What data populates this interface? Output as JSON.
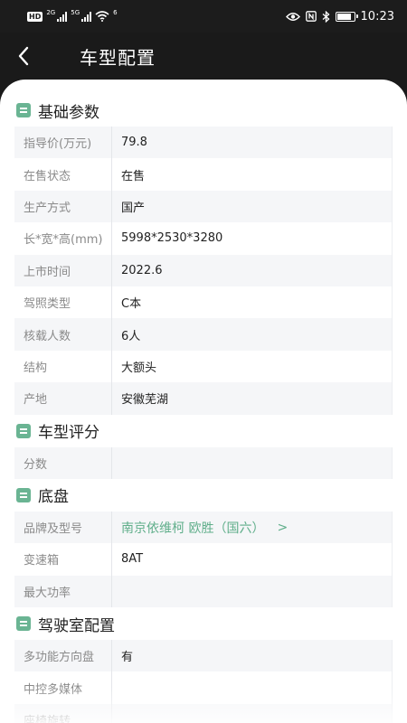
{
  "status_bar": {
    "hd_badge": "HD",
    "net1": "2G",
    "net2": "5G",
    "wifi_label": "6",
    "time": "10:23",
    "battery_level": 0.85
  },
  "header": {
    "title": "车型配置"
  },
  "sections": [
    {
      "title": "基础参数",
      "rows": [
        {
          "label": "指导价(万元)",
          "value": "79.8"
        },
        {
          "label": "在售状态",
          "value": "在售"
        },
        {
          "label": "生产方式",
          "value": "国产"
        },
        {
          "label": "长*宽*高(mm)",
          "value": "5998*2530*3280"
        },
        {
          "label": "上市时间",
          "value": "2022.6"
        },
        {
          "label": "驾照类型",
          "value": "C本"
        },
        {
          "label": "核载人数",
          "value": "6人"
        },
        {
          "label": "结构",
          "value": "大额头"
        },
        {
          "label": "产地",
          "value": "安徽芜湖"
        }
      ]
    },
    {
      "title": "车型评分",
      "rows": [
        {
          "label": "分数",
          "value": ""
        }
      ]
    },
    {
      "title": "底盘",
      "rows": [
        {
          "label": "品牌及型号",
          "value": "南京依维柯 欧胜（国六）",
          "link_arrow": ">"
        },
        {
          "label": "变速箱",
          "value": "8AT"
        },
        {
          "label": "最大功率",
          "value": ""
        }
      ]
    },
    {
      "title": "驾驶室配置",
      "rows": [
        {
          "label": "多功能方向盘",
          "value": "有"
        },
        {
          "label": "中控多媒体",
          "value": ""
        },
        {
          "label": "座椅旋转",
          "value": ""
        }
      ]
    }
  ],
  "colors": {
    "accent": "#6ab493",
    "link": "#5fae8a",
    "header_bg": "#1a1a1a"
  },
  "icons": {
    "back": "chevron-left-icon",
    "section": "list-icon",
    "eye": "eye-icon",
    "nfc": "nfc-icon",
    "bluetooth": "bluetooth-icon",
    "wifi": "wifi-icon",
    "battery": "battery-icon"
  }
}
